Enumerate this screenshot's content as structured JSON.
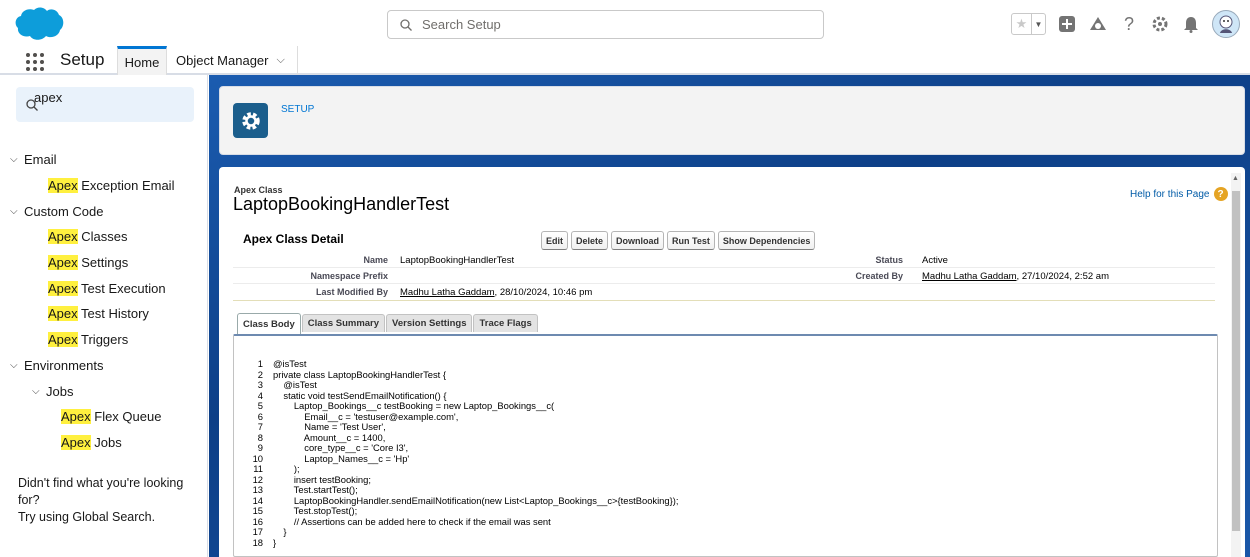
{
  "header": {
    "search_placeholder": "Search Setup",
    "icons": [
      "star-icon",
      "add-icon",
      "trailhead-icon",
      "help-icon",
      "gear-icon",
      "bell-icon",
      "avatar"
    ]
  },
  "nav": {
    "app_name": "Setup",
    "tabs": [
      {
        "label": "Home",
        "active": true
      },
      {
        "label": "Object Manager",
        "active": false
      }
    ]
  },
  "sidebar": {
    "search_value": "apex",
    "tree": [
      {
        "type": "section",
        "label": "Email"
      },
      {
        "type": "item",
        "label": "Apex Exception Email"
      },
      {
        "type": "section",
        "label": "Custom Code"
      },
      {
        "type": "item",
        "label": "Apex Classes"
      },
      {
        "type": "item",
        "label": "Apex Settings"
      },
      {
        "type": "item",
        "label": "Apex Test Execution"
      },
      {
        "type": "item",
        "label": "Apex Test History"
      },
      {
        "type": "item",
        "label": "Apex Triggers"
      },
      {
        "type": "section",
        "label": "Environments"
      },
      {
        "type": "subsection",
        "label": "Jobs"
      },
      {
        "type": "subitem",
        "label": "Apex Flex Queue"
      },
      {
        "type": "subitem",
        "label": "Apex Jobs"
      }
    ],
    "not_found_line1": "Didn't find what you're looking for?",
    "not_found_line2": "Try using Global Search."
  },
  "setup_card": {
    "label": "SETUP"
  },
  "apex_class": {
    "type_label": "Apex Class",
    "name": "LaptopBookingHandlerTest",
    "help_link": "Help for this Page",
    "detail_title": "Apex Class Detail",
    "buttons": [
      "Edit",
      "Delete",
      "Download",
      "Run Test",
      "Show Dependencies"
    ],
    "fields": {
      "name_label": "Name",
      "name_value": "LaptopBookingHandlerTest",
      "status_label": "Status",
      "status_value": "Active",
      "namespace_label": "Namespace Prefix",
      "namespace_value": "",
      "created_by_label": "Created By",
      "created_by_user": "Madhu Latha Gaddam",
      "created_by_date": ", 27/10/2024, 2:52 am",
      "modified_label": "Last Modified By",
      "modified_user": "Madhu Latha Gaddam",
      "modified_date": ", 28/10/2024, 10:46 pm"
    },
    "tabs": [
      "Class Body",
      "Class Summary",
      "Version Settings",
      "Trace Flags"
    ],
    "code": [
      "@isTest",
      "private class LaptopBookingHandlerTest {",
      "    @isTest",
      "    static void testSendEmailNotification() {",
      "        Laptop_Bookings__c testBooking = new Laptop_Bookings__c(",
      "            Email__c = 'testuser@example.com',",
      "            Name = 'Test User',",
      "            Amount__c = 1400,",
      "            core_type__c = 'Core I3',",
      "            Laptop_Names__c = 'Hp'",
      "        );",
      "        insert testBooking;",
      "        Test.startTest();",
      "        LaptopBookingHandler.sendEmailNotification(new List<Laptop_Bookings__c>{testBooking});",
      "        Test.stopTest();",
      "        // Assertions can be added here to check if the email was sent",
      "    }",
      "}"
    ]
  }
}
